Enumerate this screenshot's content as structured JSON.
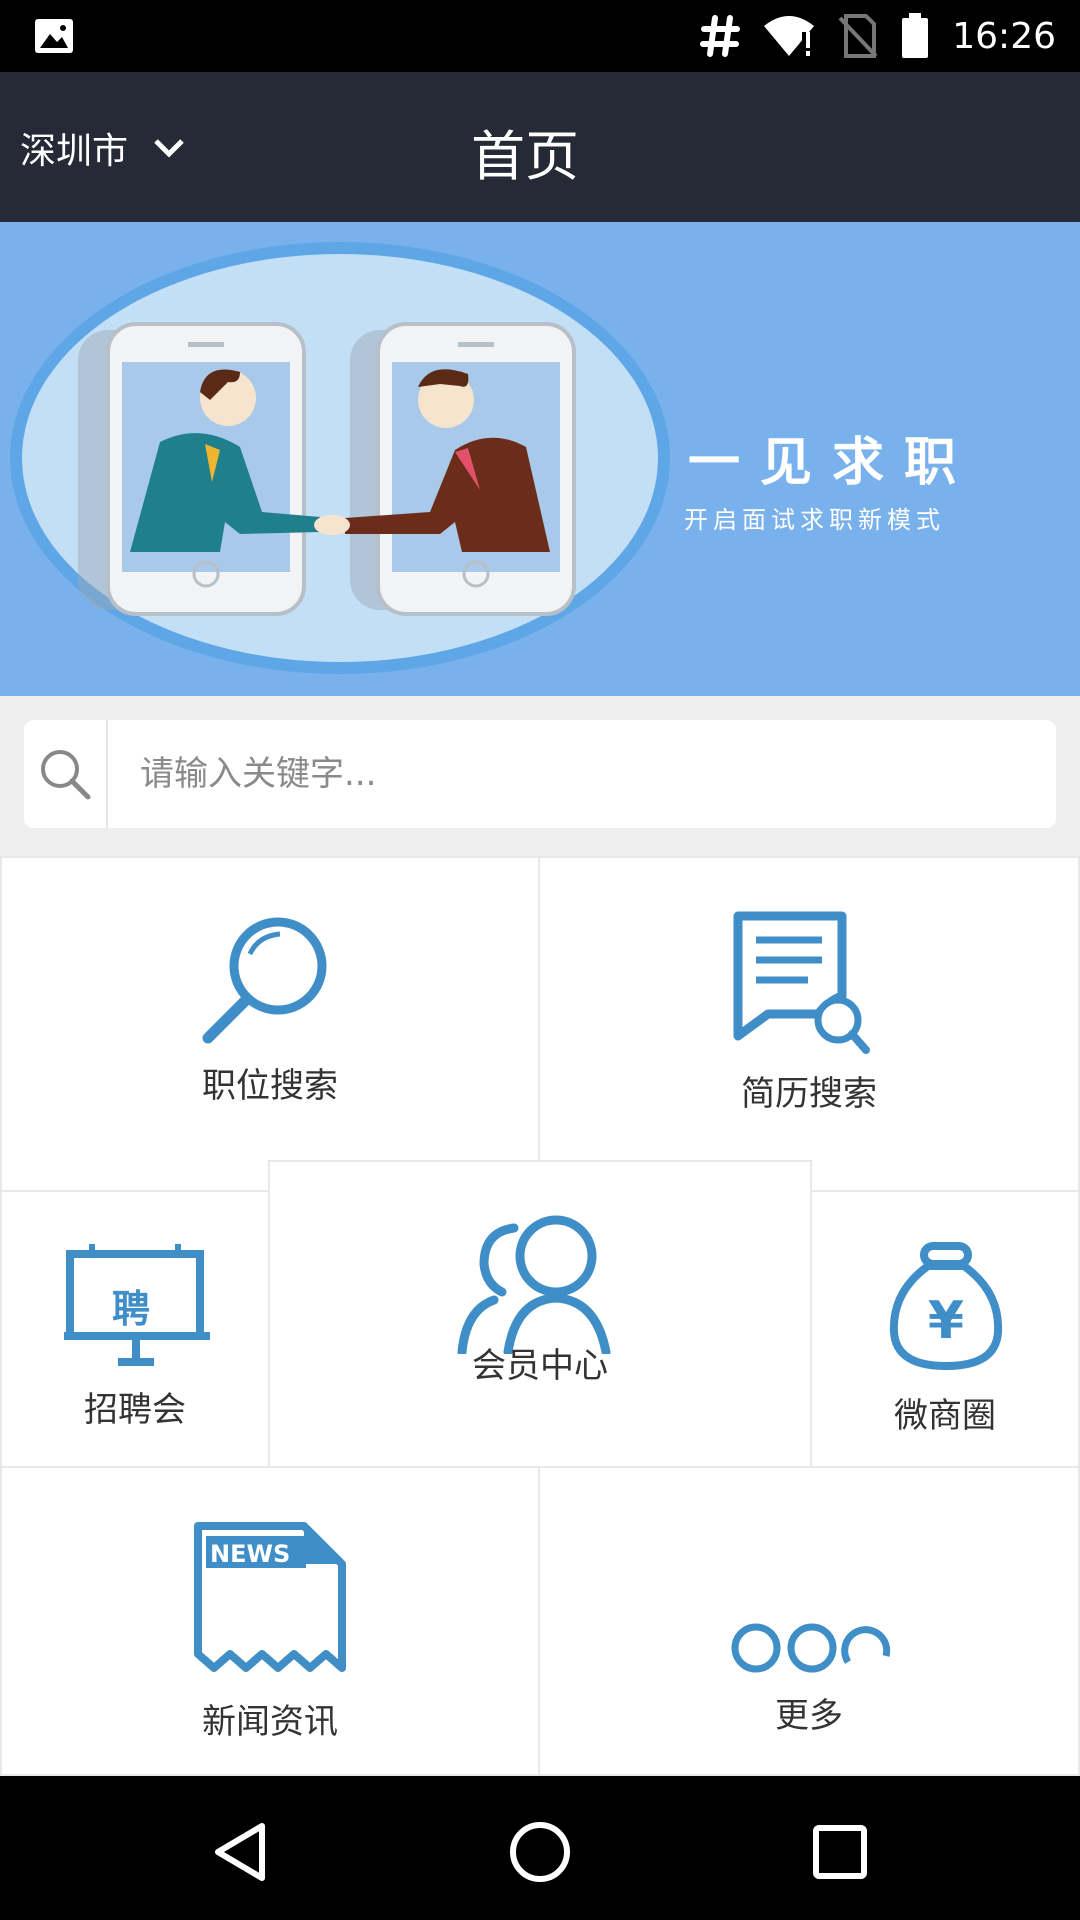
{
  "status_bar": {
    "time": "16:26"
  },
  "header": {
    "city": "深圳市",
    "title": "首页"
  },
  "banner": {
    "slogan": "一见求职",
    "subslogan": "开启面试求职新模式"
  },
  "search": {
    "placeholder": "请输入关键字..."
  },
  "grid": {
    "job_search": "职位搜索",
    "resume_search": "简历搜索",
    "job_fair": "招聘会",
    "job_fair_sign": "聘",
    "member_center": "会员中心",
    "wechat_circle": "微商圈",
    "news": "新闻资讯",
    "news_tag": "NEWS",
    "more": "更多"
  },
  "colors": {
    "accent": "#3f8ec7",
    "header_bg": "#262a36",
    "banner_bg": "#79b1ec"
  }
}
